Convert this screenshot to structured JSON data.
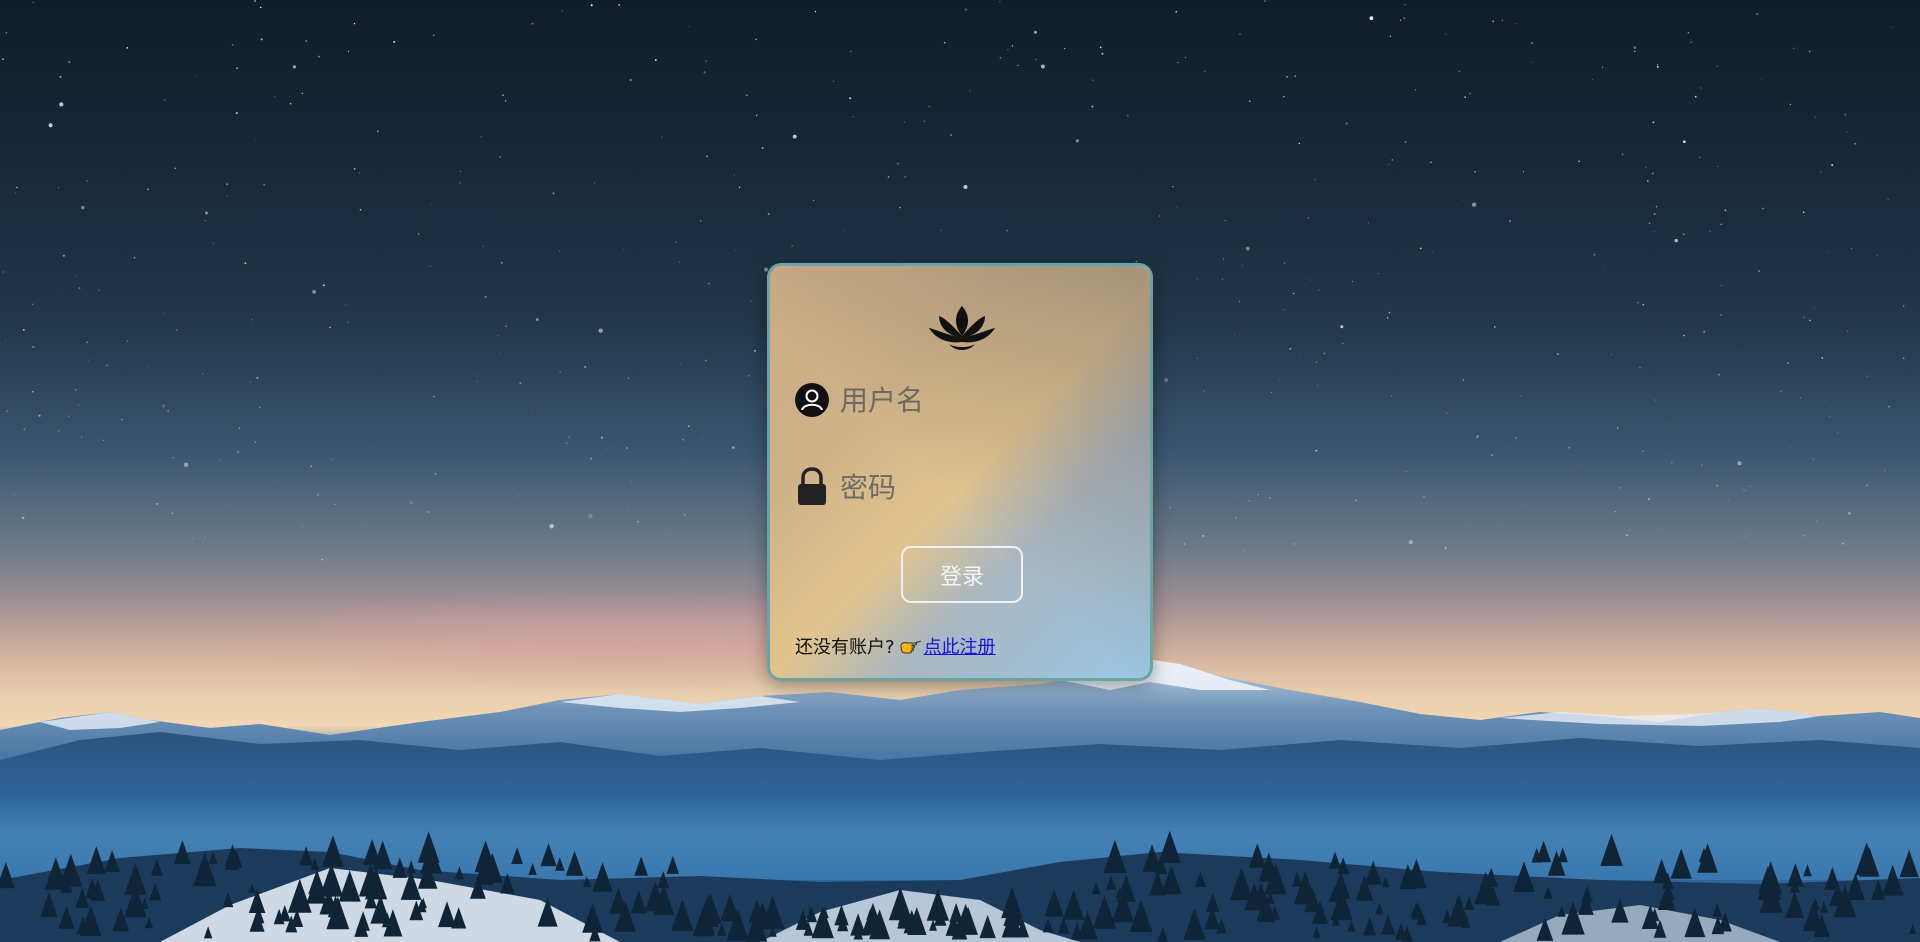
{
  "login": {
    "username_placeholder": "用户名",
    "password_placeholder": "密码",
    "submit_label": "登录",
    "register_prompt": "还没有账户?",
    "register_link": "点此注册"
  },
  "icons": {
    "logo": "lotus-icon",
    "username": "user-circle-icon",
    "password": "lock-icon",
    "register": "pointing-hand-icon"
  },
  "colors": {
    "link": "#1a14d8",
    "button_border": "#f2f2f2",
    "card_border": "#5aa0a5"
  }
}
